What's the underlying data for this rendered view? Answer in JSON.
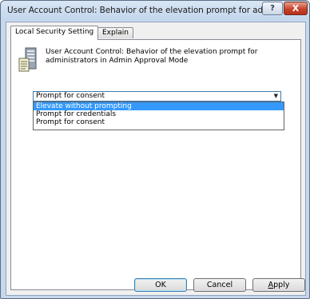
{
  "window": {
    "title": "User Account Control: Behavior of the elevation prompt for ad...",
    "help_glyph": "?",
    "close_glyph": "X"
  },
  "tabs": [
    {
      "label": "Local Security Setting",
      "active": true
    },
    {
      "label": "Explain",
      "active": false
    }
  ],
  "policy": {
    "icon": "server-policy-icon",
    "description": "User Account Control: Behavior of the elevation prompt for administrators in Admin Approval Mode"
  },
  "dropdown": {
    "selected": "Prompt for consent",
    "arrow_icon": "chevron-down-icon",
    "options": [
      {
        "label": "Elevate without prompting",
        "highlighted": true
      },
      {
        "label": "Prompt for credentials",
        "highlighted": false
      },
      {
        "label": "Prompt for consent",
        "highlighted": false
      }
    ]
  },
  "buttons": {
    "ok": "OK",
    "cancel": "Cancel",
    "apply_first": "A",
    "apply_rest": "pply"
  },
  "colors": {
    "highlight": "#3399ff",
    "close_button": "#c8432a"
  }
}
